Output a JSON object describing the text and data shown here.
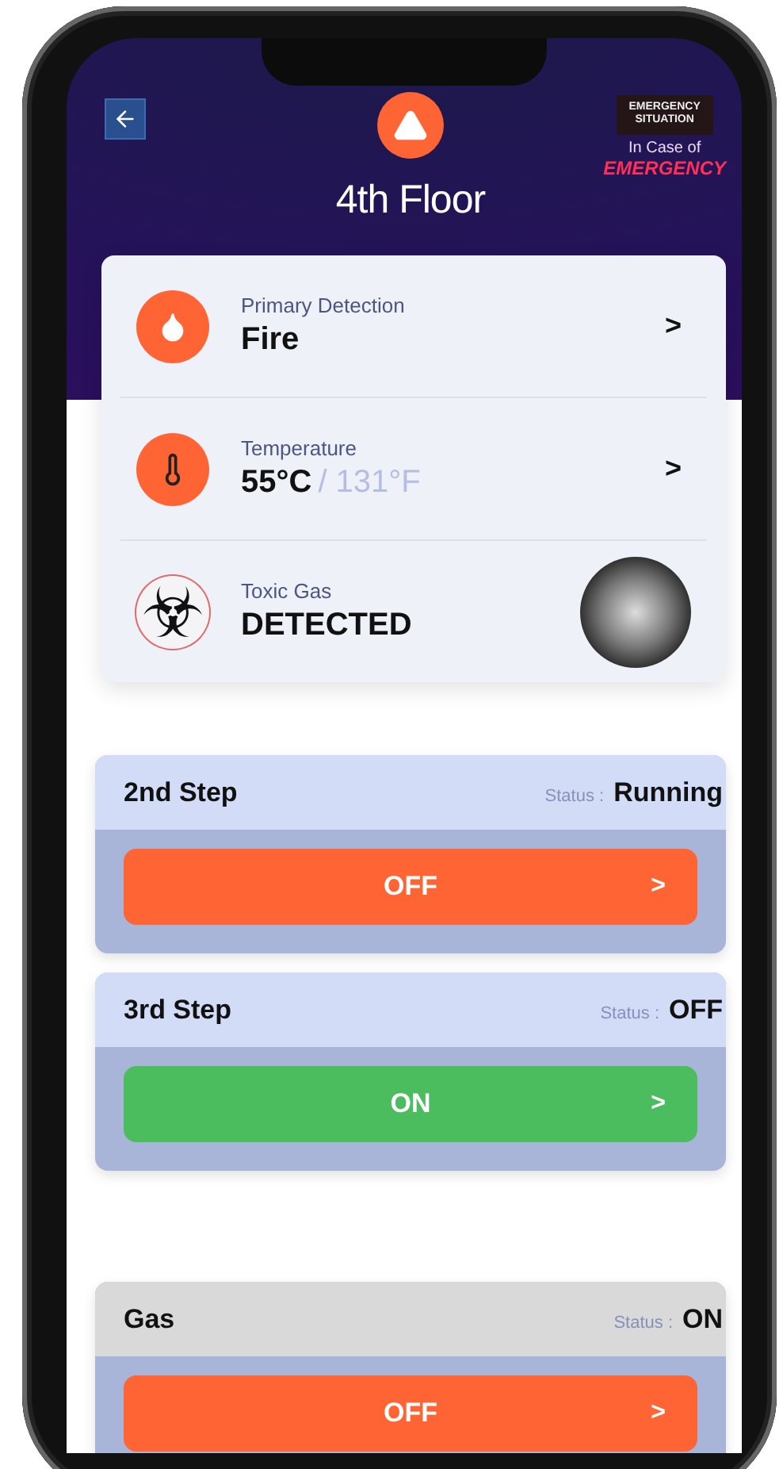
{
  "header": {
    "title": "4th Floor",
    "badge": {
      "line_1": "EMERGENCY",
      "line_2": "SITUATION",
      "caption": "In Case of",
      "emphasis": "EMERGENCY"
    }
  },
  "detections": [
    {
      "kind": "fire",
      "label": "Primary Detection",
      "value": "Fire",
      "chevron": ">"
    },
    {
      "kind": "temperature",
      "label": "Temperature",
      "value": "55°C",
      "secondary": "/ 131°F",
      "chevron": ">"
    },
    {
      "kind": "toxic",
      "label": "Toxic Gas",
      "value": "DETECTED"
    }
  ],
  "steps": [
    {
      "name": "2nd Step",
      "status_label": "Status :",
      "status": "Running",
      "color": "#d3dcf7",
      "button": {
        "label": "OFF",
        "color": "#fe6434",
        "chevron": ">"
      }
    },
    {
      "name": "3rd Step",
      "status_label": "Status :",
      "status": "OFF",
      "color": "#d3dcf7",
      "button": {
        "label": "ON",
        "color": "#4cbd5e",
        "chevron": ">"
      }
    },
    {
      "name": "Gas",
      "status_label": "Status :",
      "status": "ON",
      "color": "#d9d9d9",
      "button": {
        "label": "OFF",
        "color": "#fe6434",
        "chevron": ">"
      }
    }
  ]
}
